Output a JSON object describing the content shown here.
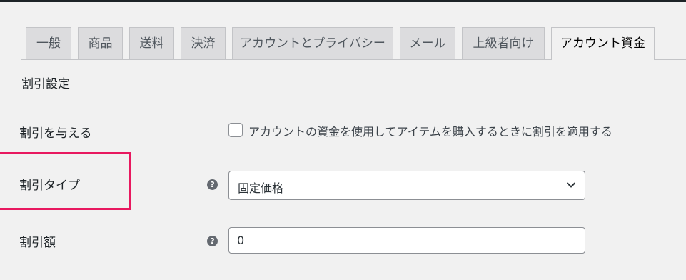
{
  "tabs": [
    {
      "label": "一般"
    },
    {
      "label": "商品"
    },
    {
      "label": "送料"
    },
    {
      "label": "決済"
    },
    {
      "label": "アカウントとプライバシー"
    },
    {
      "label": "メール"
    },
    {
      "label": "上級者向け"
    },
    {
      "label": "アカウント資金",
      "active": true
    }
  ],
  "section": {
    "title": "割引設定"
  },
  "fields": {
    "give_discount": {
      "label": "割引を与える",
      "checkbox_label": "アカウントの資金を使用してアイテムを購入するときに割引を適用する",
      "checked": false
    },
    "discount_type": {
      "label": "割引タイプ",
      "help_icon": "question-circle-icon",
      "value": "固定価格"
    },
    "discount_amount": {
      "label": "割引額",
      "help_icon": "question-circle-icon",
      "value": "0"
    }
  },
  "colors": {
    "highlight": "#e8185f",
    "tab_inactive": "#dcdcde",
    "background": "#f1f1f1"
  }
}
